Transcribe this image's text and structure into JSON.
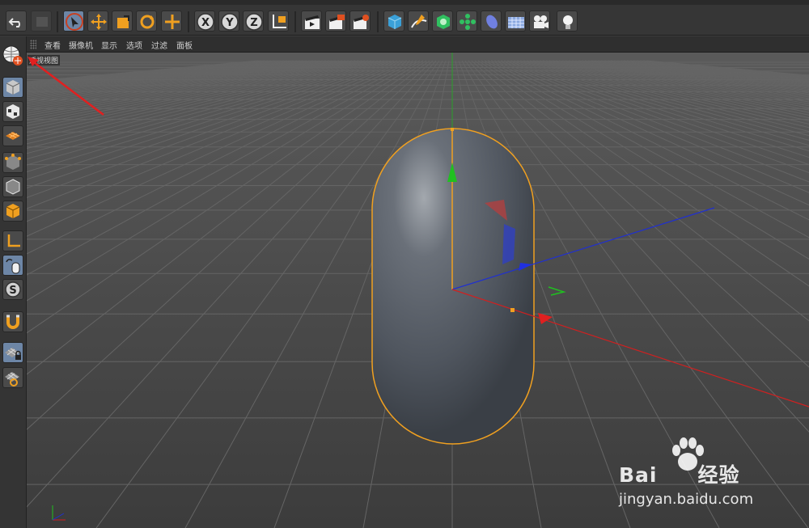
{
  "viewport_menu": {
    "items": [
      {
        "label": "查看"
      },
      {
        "label": "摄像机"
      },
      {
        "label": "显示"
      },
      {
        "label": "选项"
      },
      {
        "label": "过滤"
      },
      {
        "label": "面板"
      }
    ]
  },
  "viewport": {
    "label": "透视视图",
    "object_color": "#575d66",
    "axis_colors": {
      "x": "#e02020",
      "y": "#20c020",
      "z": "#2030e0"
    },
    "selection_color": "#f0a020"
  },
  "toolbar": {
    "axis_x": "X",
    "axis_y": "Y",
    "axis_z": "Z"
  },
  "watermark": {
    "brand": "Bai",
    "brand_cn": "经验",
    "url": "jingyan.baidu.com"
  },
  "colors": {
    "accent": "#6d86a6",
    "annotation_arrow": "#e02020"
  }
}
